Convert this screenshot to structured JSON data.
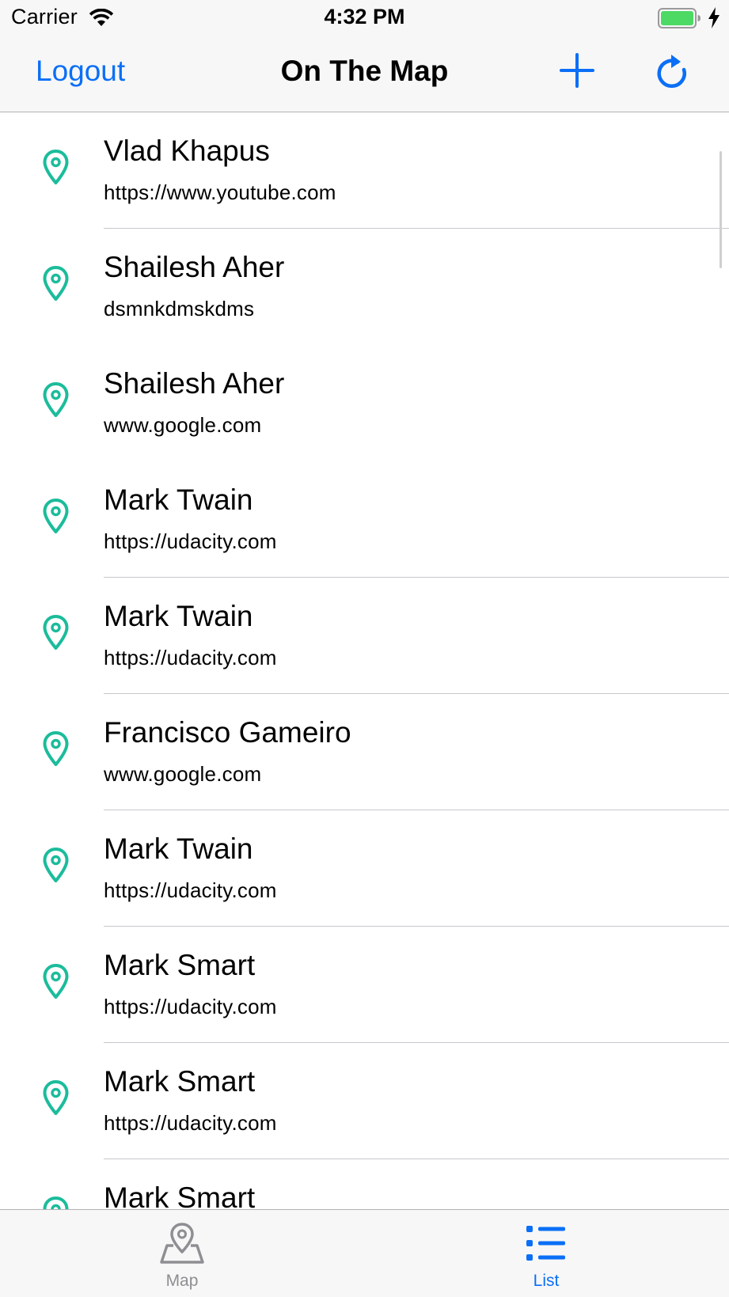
{
  "status_bar": {
    "carrier": "Carrier",
    "time": "4:32 PM",
    "battery_color": "#4cd964"
  },
  "nav": {
    "left_button": "Logout",
    "title": "On The Map",
    "add_icon": "plus-icon",
    "refresh_icon": "refresh-icon",
    "accent_color": "#0a6ff6"
  },
  "list": {
    "pin_color": "#1bbc9b",
    "items": [
      {
        "name": "Vlad Khapus",
        "url": "https://www.youtube.com"
      },
      {
        "name": "Shailesh Aher",
        "url": "dsmnkdmskdms"
      },
      {
        "name": "Shailesh Aher",
        "url": "www.google.com"
      },
      {
        "name": "Mark Twain",
        "url": "https://udacity.com"
      },
      {
        "name": "Mark Twain",
        "url": "https://udacity.com"
      },
      {
        "name": "Francisco Gameiro",
        "url": "www.google.com"
      },
      {
        "name": "Mark Twain",
        "url": "https://udacity.com"
      },
      {
        "name": "Mark Smart",
        "url": "https://udacity.com"
      },
      {
        "name": "Mark Smart",
        "url": "https://udacity.com"
      },
      {
        "name": "Mark Smart",
        "url": ""
      }
    ]
  },
  "tabs": {
    "map": {
      "label": "Map",
      "icon": "map-icon"
    },
    "list": {
      "label": "List",
      "icon": "list-icon"
    }
  }
}
